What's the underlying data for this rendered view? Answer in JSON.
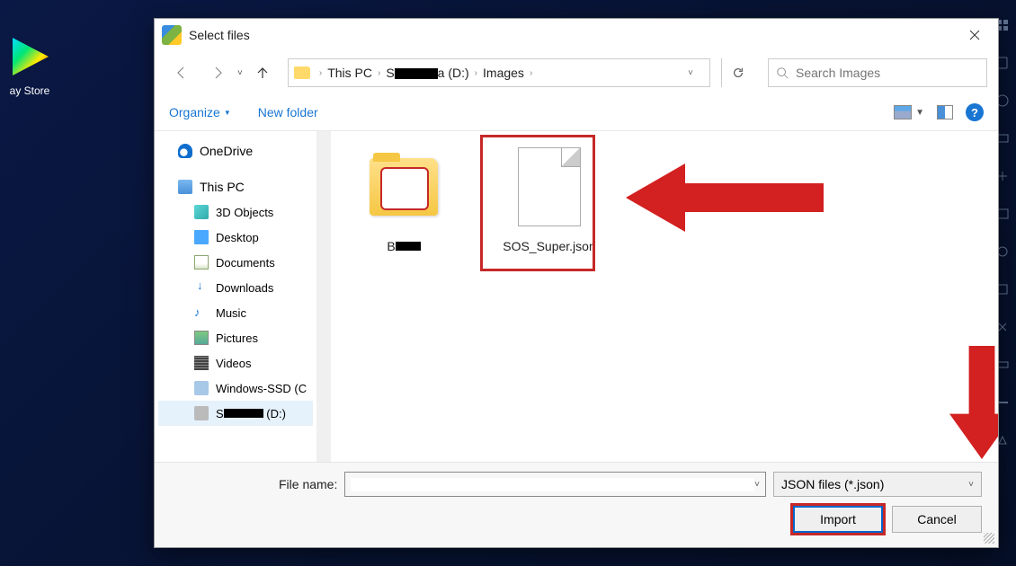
{
  "desktop": {
    "play_store_label": "ay Store"
  },
  "dialog": {
    "title": "Select files"
  },
  "breadcrumb": {
    "segments": [
      "This PC",
      "████ (D:)",
      "Images"
    ]
  },
  "search": {
    "placeholder": "Search Images"
  },
  "toolbar": {
    "organize": "Organize",
    "new_folder": "New folder"
  },
  "sidebar": {
    "onedrive": "OneDrive",
    "this_pc": "This PC",
    "items": {
      "objects3d": "3D Objects",
      "desktop": "Desktop",
      "documents": "Documents",
      "downloads": "Downloads",
      "music": "Music",
      "pictures": "Pictures",
      "videos": "Videos",
      "ssd": "Windows-SSD (C",
      "drive_d": "S████ (D:)"
    }
  },
  "files": {
    "folder1_label": "B███",
    "selected_file": "SOS_Super.json"
  },
  "footer": {
    "label": "File name:",
    "value": "",
    "filter": "JSON files (*.json)",
    "import": "Import",
    "cancel": "Cancel"
  }
}
